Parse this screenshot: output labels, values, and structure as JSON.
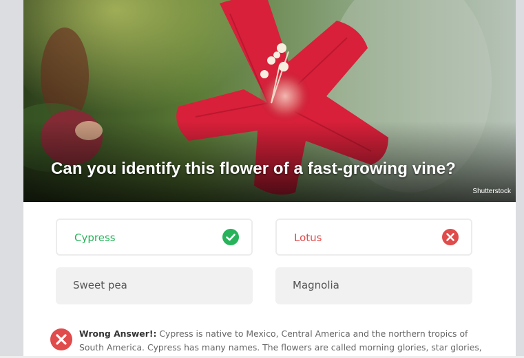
{
  "quiz": {
    "question": "Can you identify this flower of a fast-growing vine?",
    "image_credit": "Shutterstock",
    "options": [
      {
        "label": "Cypress",
        "state": "correct",
        "icon": "check-circle-icon"
      },
      {
        "label": "Lotus",
        "state": "wrong",
        "icon": "x-circle-icon"
      },
      {
        "label": "Sweet pea",
        "state": "neutral"
      },
      {
        "label": "Magnolia",
        "state": "neutral"
      }
    ],
    "feedback": {
      "heading": "Wrong Answer!:",
      "text": " Cypress is native to Mexico, Central America and the northern tropics of South America. Cypress has many names. The flowers are called morning glories, star glories, cardinal creepers, cypress vines and hummingbird vines."
    }
  },
  "colors": {
    "correct": "#27b35a",
    "wrong": "#e04b4b",
    "flower": "#d8203a"
  }
}
